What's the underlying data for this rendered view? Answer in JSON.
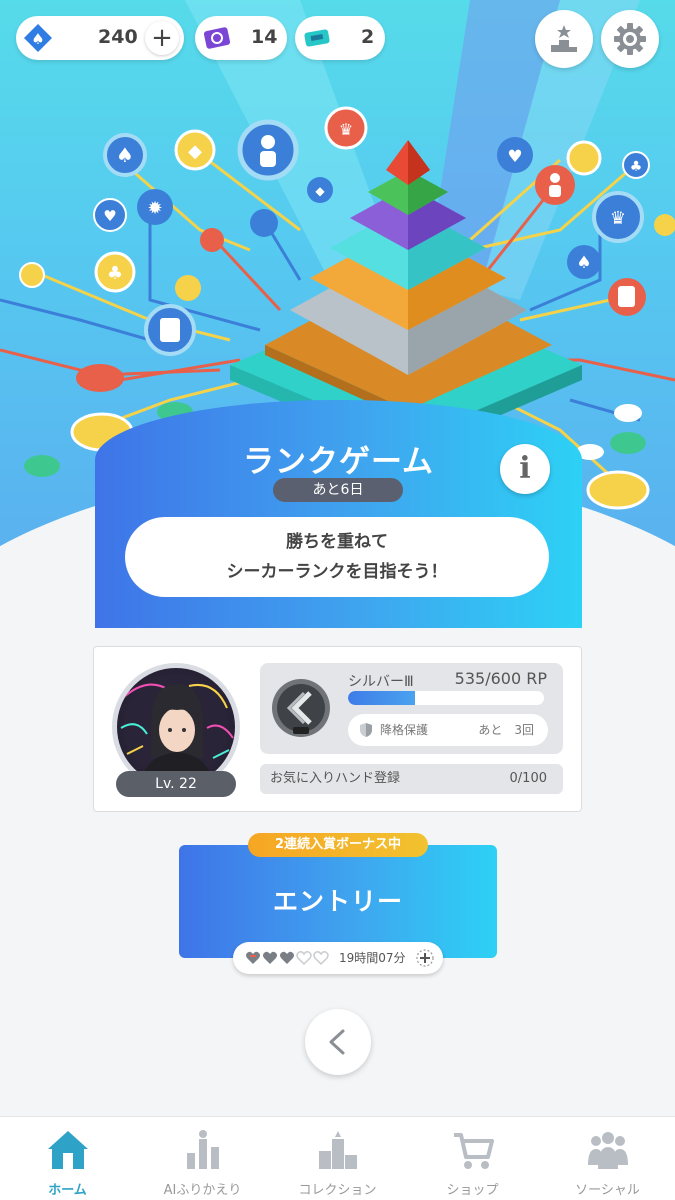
{
  "currencies": {
    "gems": {
      "icon": "blue-spade-gem-icon",
      "value": "240"
    },
    "tickets": {
      "icon": "purple-ticket-icon",
      "value": "14"
    },
    "passes": {
      "icon": "teal-pass-icon",
      "value": "2"
    }
  },
  "rank_game": {
    "title": "ランクゲーム",
    "remaining": "あと6日",
    "message_line1": "勝ちを重ねて",
    "message_line2": "シーカーランクを目指そう！"
  },
  "player": {
    "level": "Lv. 22",
    "rank_name": "シルバーⅢ",
    "rank_points": "535/600 RP",
    "rank_progress": 0.34,
    "protection_label": "降格保護",
    "protection_count": "あと　3回",
    "favorite_label": "お気に入りハンド登録",
    "favorite_count": "0/100"
  },
  "entry": {
    "bonus_label": "2連続入賞ボーナス中",
    "button_label": "エントリー",
    "timer": "19時間07分"
  },
  "nav": {
    "items": [
      {
        "label": "ホーム",
        "icon": "home-icon",
        "active": true
      },
      {
        "label": "AIふりかえり",
        "icon": "bar-chart-icon",
        "active": false
      },
      {
        "label": "コレクション",
        "icon": "podium-icon",
        "active": false
      },
      {
        "label": "ショップ",
        "icon": "cart-icon",
        "active": false
      },
      {
        "label": "ソーシャル",
        "icon": "people-icon",
        "active": false
      }
    ]
  },
  "colors": {
    "accent_blue": "#3f74e8",
    "accent_cyan": "#2dd1f5",
    "bonus_orange": "#f6a623",
    "nav_active": "#2fa3c7"
  }
}
